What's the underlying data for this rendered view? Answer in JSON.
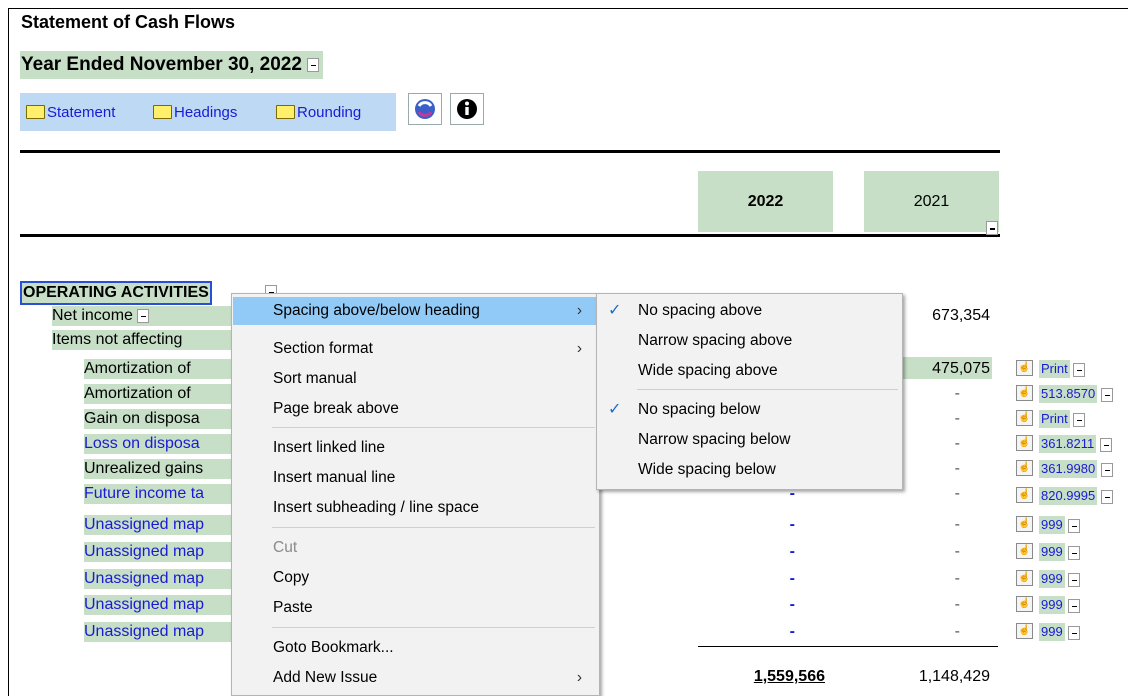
{
  "header": {
    "title": "Statement of Cash Flows",
    "period": "Year Ended November 30, 2022"
  },
  "toolbar": {
    "statement": "Statement",
    "headings": "Headings",
    "rounding": "Rounding"
  },
  "columns": {
    "current": "2022",
    "prior": "2021"
  },
  "section": {
    "heading": "OPERATING ACTIVITIES"
  },
  "rows": [
    {
      "label": "Net income",
      "current": "",
      "prior": "673,354"
    },
    {
      "label": "Items not affecting",
      "current": "",
      "prior": ""
    },
    {
      "label": "Amortization of",
      "current": "",
      "prior": "475,075",
      "ref": "Print"
    },
    {
      "label": "Amortization of",
      "current": "",
      "prior": "-",
      "ref": "513.8570"
    },
    {
      "label": "Gain on disposa",
      "current": "",
      "prior": "-",
      "ref": "Print"
    },
    {
      "label": "Loss on disposa",
      "current": "",
      "prior": "-",
      "ref": "361.8211"
    },
    {
      "label": "Unrealized gains",
      "current": "",
      "prior": "-",
      "ref": "361.9980"
    },
    {
      "label": "Future income ta",
      "current": "-",
      "prior": "-",
      "ref": "820.9995"
    },
    {
      "label": "Unassigned map",
      "current": "-",
      "prior": "-",
      "ref": "999"
    },
    {
      "label": "Unassigned map",
      "current": "-",
      "prior": "-",
      "ref": "999"
    },
    {
      "label": "Unassigned map",
      "current": "-",
      "prior": "-",
      "ref": "999"
    },
    {
      "label": "Unassigned map",
      "current": "-",
      "prior": "-",
      "ref": "999"
    },
    {
      "label": "Unassigned map",
      "current": "-",
      "prior": "-",
      "ref": "999"
    }
  ],
  "totals": {
    "current": "1,559,566",
    "prior": "1,148,429"
  },
  "context_menu": {
    "items": [
      "Spacing above/below heading",
      "Section format",
      "Sort manual",
      "Page break above",
      "Insert linked line",
      "Insert manual line",
      "Insert subheading / line space",
      "Cut",
      "Copy",
      "Paste",
      "Goto Bookmark...",
      "Add New Issue"
    ]
  },
  "submenu": {
    "items": [
      "No spacing above",
      "Narrow spacing above",
      "Wide spacing above",
      "No spacing below",
      "Narrow spacing below",
      "Wide spacing below"
    ]
  },
  "colors": {
    "highlight_green": "#c6dfc6",
    "toolbar_blue": "#bed9f4",
    "link_blue": "#1a1ad6",
    "menu_selected": "#91c9f7"
  }
}
